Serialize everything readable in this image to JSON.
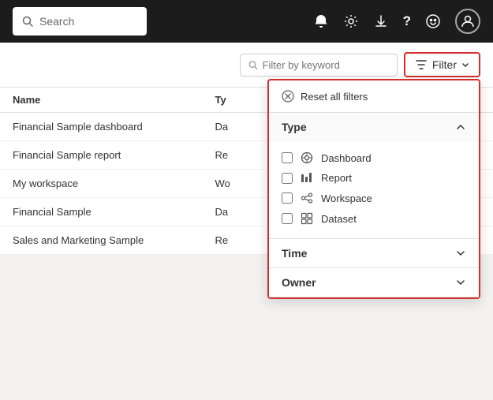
{
  "topbar": {
    "search_placeholder": "Search",
    "icons": {
      "bell": "🔔",
      "settings": "⚙",
      "download": "⬇",
      "help": "?",
      "smiley": "☺",
      "avatar": "👤"
    }
  },
  "filter_bar": {
    "keyword_placeholder": "Filter by keyword",
    "filter_button_label": "Filter",
    "filter_icon": "≡"
  },
  "table": {
    "columns": [
      "Name",
      "Ty",
      ""
    ],
    "rows": [
      {
        "name": "Financial Sample dashboard",
        "type": "Da"
      },
      {
        "name": "Financial Sample report",
        "type": "Re"
      },
      {
        "name": "My workspace",
        "type": "Wo"
      },
      {
        "name": "Financial Sample",
        "type": "Da"
      },
      {
        "name": "Sales and Marketing Sample",
        "type": "Re"
      }
    ]
  },
  "filter_panel": {
    "reset_label": "Reset all filters",
    "reset_icon": "⊗",
    "sections": [
      {
        "id": "type",
        "label": "Type",
        "expanded": true,
        "items": [
          {
            "id": "dashboard",
            "label": "Dashboard",
            "icon": "⊙",
            "checked": false
          },
          {
            "id": "report",
            "label": "Report",
            "icon": "📊",
            "checked": false
          },
          {
            "id": "workspace",
            "label": "Workspace",
            "icon": "🔗",
            "checked": false
          },
          {
            "id": "dataset",
            "label": "Dataset",
            "icon": "⊞",
            "checked": false
          }
        ]
      },
      {
        "id": "time",
        "label": "Time",
        "expanded": false,
        "items": []
      },
      {
        "id": "owner",
        "label": "Owner",
        "expanded": false,
        "items": []
      }
    ]
  }
}
